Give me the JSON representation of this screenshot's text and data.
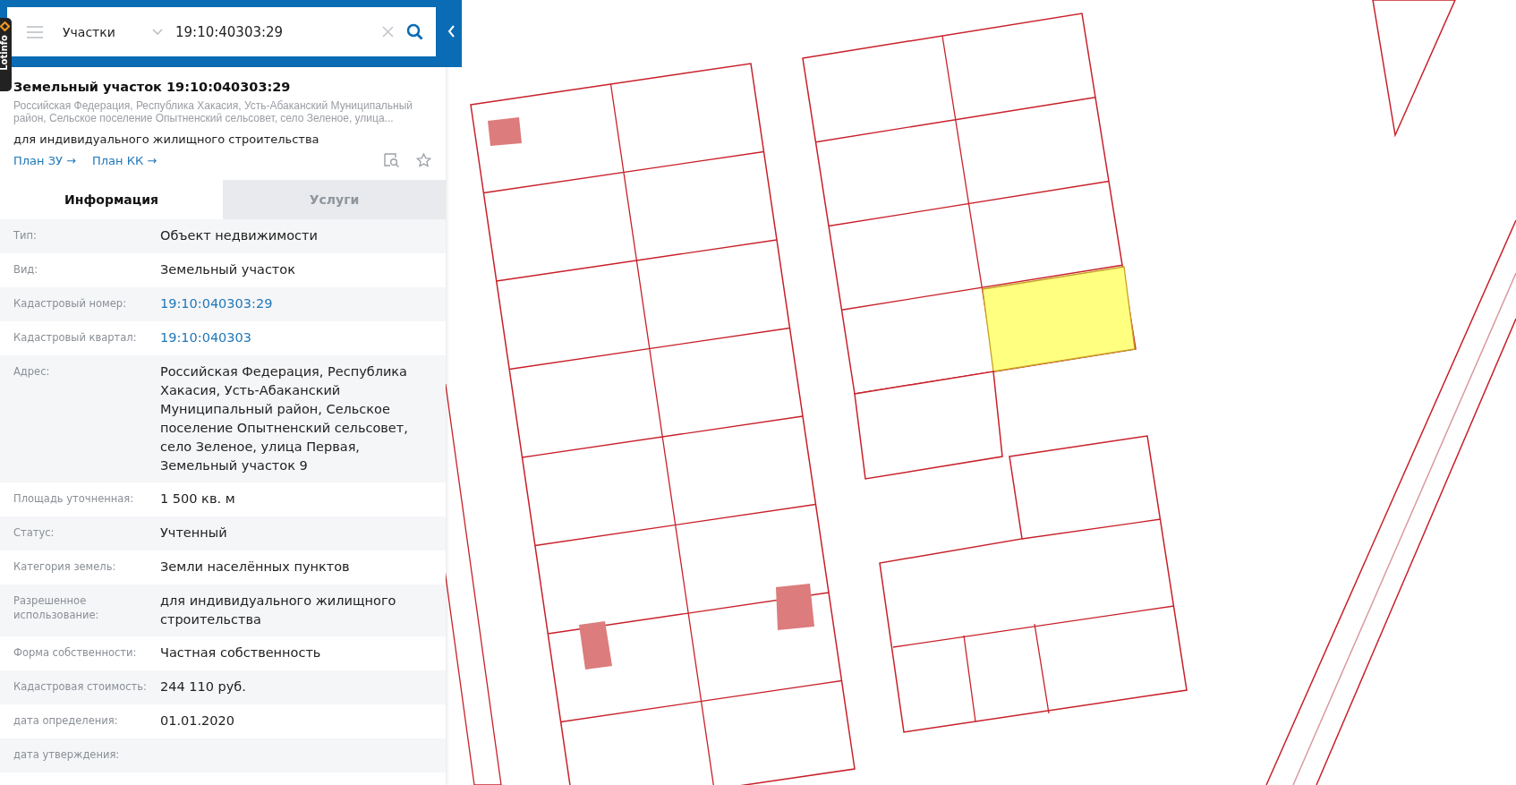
{
  "extension_tab": {
    "label": "Lotinfo"
  },
  "search": {
    "layer": "Участки",
    "value": "19:10:40303:29"
  },
  "object": {
    "title": "Земельный участок 19:10:040303:29",
    "address": "Российская Федерация, Республика Хакасия, Усть-Абаканский Муниципальный район, Сельское поселение Опытненский сельсовет, село Зеленое, улица...",
    "purpose": "для индивидуального жилищного строительства",
    "links": [
      "План ЗУ →",
      "План КК →"
    ]
  },
  "tabs": [
    {
      "label": "Информация",
      "selected": true
    },
    {
      "label": "Услуги",
      "selected": false
    }
  ],
  "fields": [
    {
      "label": "Тип:",
      "value": "Объект недвижимости",
      "kind": "text"
    },
    {
      "label": "Вид:",
      "value": "Земельный участок",
      "kind": "text"
    },
    {
      "label": "Кадастровый номер:",
      "value": "19:10:040303:29",
      "kind": "link"
    },
    {
      "label": "Кадастровый квартал:",
      "value": "19:10:040303",
      "kind": "link"
    },
    {
      "label": "Адрес:",
      "value": "Российская Федерация, Республика Хакасия, Усть-Абаканский Муниципальный район, Сельское поселение Опытненский сельсовет, село Зеленое, улица Первая, Земельный участок 9",
      "kind": "text"
    },
    {
      "label": "Площадь уточненная:",
      "value": "1 500 кв. м",
      "kind": "text"
    },
    {
      "label": "Статус:",
      "value": "Учтенный",
      "kind": "text"
    },
    {
      "label": "Категория земель:",
      "value": "Земли населённых пунктов",
      "kind": "text"
    },
    {
      "label": "Разрешенное использование:",
      "value": "для индивидуального жилищного строительства",
      "kind": "text"
    },
    {
      "label": "Форма собственности:",
      "value": "Частная собственность",
      "kind": "text"
    },
    {
      "label": "Кадастровая стоимость:",
      "value": "244 110 руб.",
      "kind": "text"
    },
    {
      "label": "дата определения:",
      "value": "01.01.2020",
      "kind": "text"
    },
    {
      "label": "дата утверждения:",
      "kind": "text"
    }
  ]
}
